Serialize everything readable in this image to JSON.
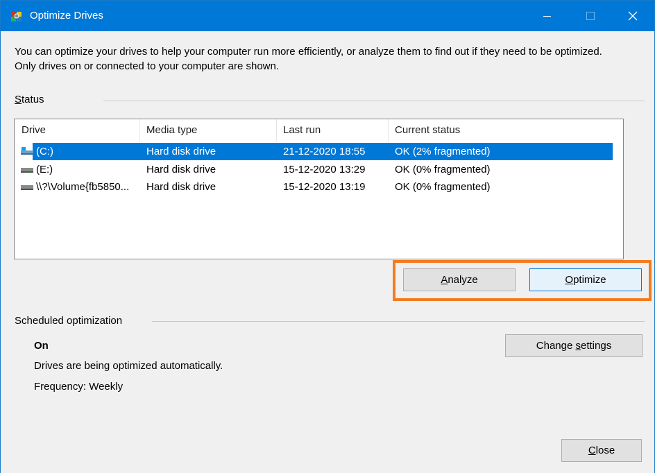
{
  "window": {
    "title": "Optimize Drives",
    "accent": "#0078d7"
  },
  "description": "You can optimize your drives to help your computer run more efficiently, or analyze them to find out if they need to be optimized. Only drives on or connected to your computer are shown.",
  "status": {
    "label_prefix": "",
    "label_underlined": "S",
    "label_rest": "tatus",
    "columns": [
      "Drive",
      "Media type",
      "Last run",
      "Current status"
    ],
    "rows": [
      {
        "icon": "system-drive-icon",
        "drive": "(C:)",
        "media": "Hard disk drive",
        "last_run": "21-12-2020 18:55",
        "status": "OK (2% fragmented)",
        "selected": true
      },
      {
        "icon": "hard-drive-icon",
        "drive": "(E:)",
        "media": "Hard disk drive",
        "last_run": "15-12-2020 13:29",
        "status": "OK (0% fragmented)",
        "selected": false
      },
      {
        "icon": "hard-drive-icon",
        "drive": "\\\\?\\Volume{fb5850...",
        "media": "Hard disk drive",
        "last_run": "15-12-2020 13:19",
        "status": "OK (0% fragmented)",
        "selected": false
      }
    ]
  },
  "buttons": {
    "analyze_pre": "",
    "analyze_u": "A",
    "analyze_post": "nalyze",
    "optimize_pre": "",
    "optimize_u": "O",
    "optimize_post": "ptimize",
    "change_pre": "Change ",
    "change_u": "s",
    "change_post": "ettings",
    "close_pre": "",
    "close_u": "C",
    "close_post": "lose"
  },
  "scheduled": {
    "label": "Scheduled optimization",
    "state": "On",
    "description": "Drives are being optimized automatically.",
    "frequency": "Frequency: Weekly"
  },
  "highlight_color": "#f47b20"
}
